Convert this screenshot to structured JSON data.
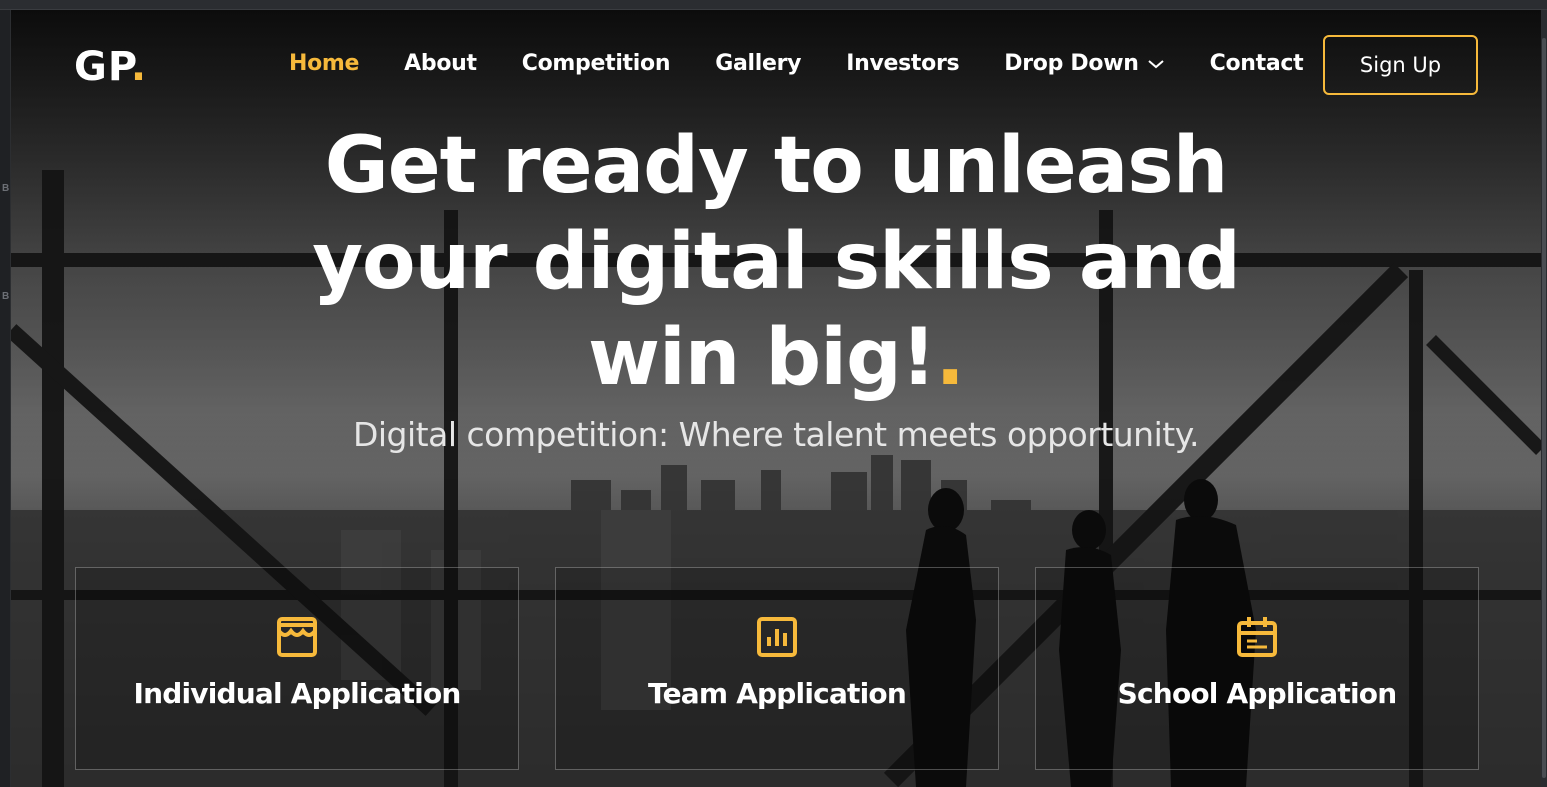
{
  "brand": {
    "logo_text": "GP",
    "logo_dot": ".",
    "accent_color": "#f6b93b"
  },
  "nav": {
    "items": [
      {
        "label": "Home",
        "active": true
      },
      {
        "label": "About",
        "active": false
      },
      {
        "label": "Competition",
        "active": false
      },
      {
        "label": "Gallery",
        "active": false
      },
      {
        "label": "Investors",
        "active": false
      },
      {
        "label": "Drop Down",
        "active": false,
        "icon": "chevron-down-icon"
      },
      {
        "label": "Contact",
        "active": false
      }
    ],
    "signup_label": "Sign Up"
  },
  "hero": {
    "headline_lines": [
      "Get ready to unleash",
      "your digital skills and",
      "win big!"
    ],
    "headline_dot": ".",
    "subtitle": "Digital competition: Where talent meets opportunity."
  },
  "cards": [
    {
      "label": "Individual Application",
      "icon": "storefront-icon"
    },
    {
      "label": "Team Application",
      "icon": "bar-chart-icon"
    },
    {
      "label": "School Application",
      "icon": "calendar-icon"
    }
  ],
  "editor_gutter": {
    "glyphs": [
      "B",
      "B"
    ]
  }
}
